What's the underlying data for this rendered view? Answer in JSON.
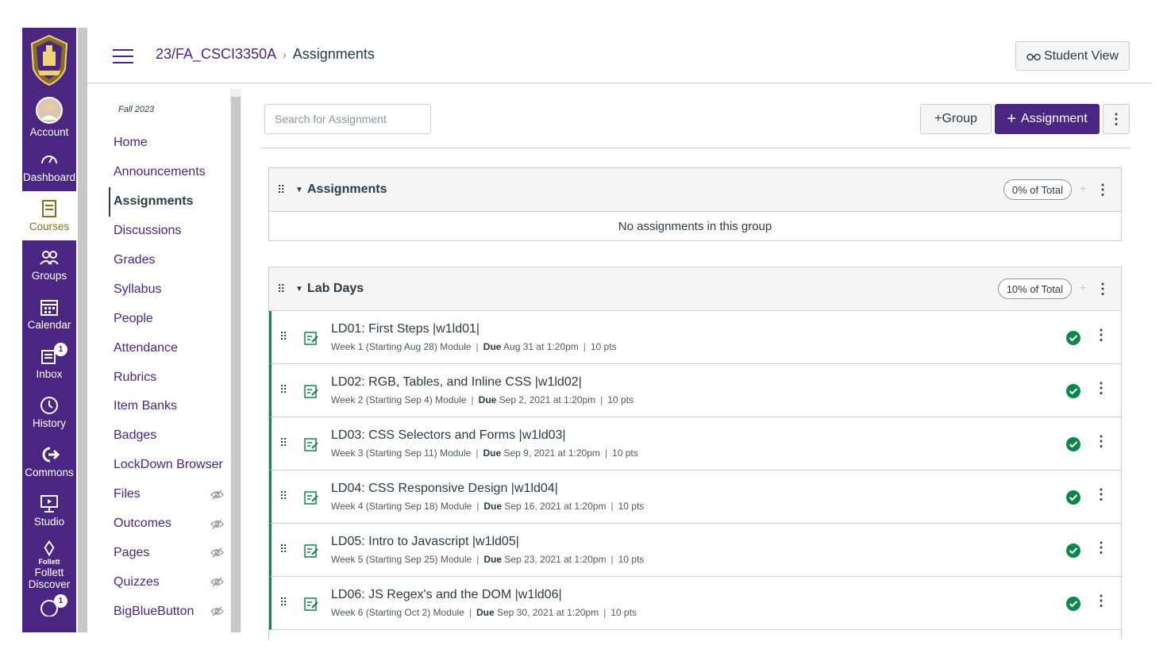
{
  "globalnav": {
    "items": [
      {
        "label": "Account",
        "icon": "account-avatar"
      },
      {
        "label": "Dashboard",
        "icon": "dashboard-icon"
      },
      {
        "label": "Courses",
        "icon": "courses-icon"
      },
      {
        "label": "Groups",
        "icon": "groups-icon"
      },
      {
        "label": "Calendar",
        "icon": "calendar-icon"
      },
      {
        "label": "Inbox",
        "icon": "inbox-icon",
        "badge": "1"
      },
      {
        "label": "History",
        "icon": "history-icon"
      },
      {
        "label": "Commons",
        "icon": "commons-icon"
      },
      {
        "label": "Studio",
        "icon": "studio-icon"
      },
      {
        "label": "Follett Discover",
        "icon": "follett-icon",
        "sublabel": "Follett"
      },
      {
        "badge": "1"
      }
    ]
  },
  "header": {
    "course": "23/FA_CSCI3350A",
    "page": "Assignments",
    "student_view": "Student View"
  },
  "coursenav": {
    "term": "Fall 2023",
    "items": [
      {
        "label": "Home"
      },
      {
        "label": "Announcements"
      },
      {
        "label": "Assignments"
      },
      {
        "label": "Discussions"
      },
      {
        "label": "Grades"
      },
      {
        "label": "Syllabus"
      },
      {
        "label": "People"
      },
      {
        "label": "Attendance"
      },
      {
        "label": "Rubrics"
      },
      {
        "label": "Item Banks"
      },
      {
        "label": "Badges"
      },
      {
        "label": "LockDown Browser"
      },
      {
        "label": "Files"
      },
      {
        "label": "Outcomes"
      },
      {
        "label": "Pages"
      },
      {
        "label": "Quizzes"
      },
      {
        "label": "BigBlueButton"
      }
    ]
  },
  "toolbar": {
    "search_placeholder": "Search for Assignment",
    "group_label": "Group",
    "assignment_label": "Assignment"
  },
  "groups": [
    {
      "title": "Assignments",
      "pct": "0% of Total",
      "empty": "No assignments in this group"
    },
    {
      "title": "Lab Days",
      "pct": "10% of Total"
    }
  ],
  "assignments": [
    {
      "title": "LD01: First Steps |w1ld01|",
      "module": "Week 1 (Starting Aug 28) Module",
      "due_label": "Due",
      "due": "Aug 31 at 1:20pm",
      "pts": "10 pts"
    },
    {
      "title": "LD02: RGB, Tables, and Inline CSS |w1ld02|",
      "module": "Week 2 (Starting Sep 4) Module",
      "due_label": "Due",
      "due": "Sep 2, 2021 at 1:20pm",
      "pts": "10 pts"
    },
    {
      "title": "LD03: CSS Selectors and Forms |w1ld03|",
      "module": "Week 3 (Starting Sep 11) Module",
      "due_label": "Due",
      "due": "Sep 9, 2021 at 1:20pm",
      "pts": "10 pts"
    },
    {
      "title": "LD04: CSS Responsive Design |w1ld04|",
      "module": "Week 4 (Starting Sep 18) Module",
      "due_label": "Due",
      "due": "Sep 16, 2021 at 1:20pm",
      "pts": "10 pts"
    },
    {
      "title": "LD05: Intro to Javascript |w1ld05|",
      "module": "Week 5 (Starting Sep 25) Module",
      "due_label": "Due",
      "due": "Sep 23, 2021 at 1:20pm",
      "pts": "10 pts"
    },
    {
      "title": "LD06: JS Regex's and the DOM |w1ld06|",
      "module": "Week 6 (Starting Oct 2) Module",
      "due_label": "Due",
      "due": "Sep 30, 2021 at 1:20pm",
      "pts": "10 pts"
    }
  ],
  "colors": {
    "brand": "#4b2582",
    "published": "#0b874b",
    "courses_active": "#8a6d1f"
  }
}
